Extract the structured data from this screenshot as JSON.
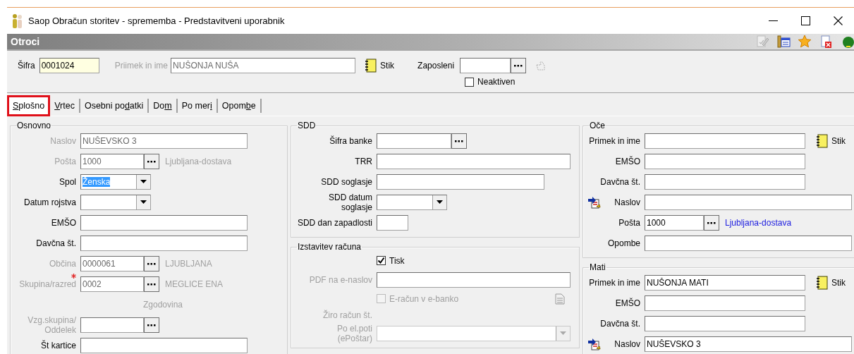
{
  "window": {
    "title": "Saop Obračun storitev - sprememba - Predstavitveni uporabnik"
  },
  "form": {
    "title": "Otroci"
  },
  "header": {
    "code": {
      "label": "Šifra",
      "value": "0001024"
    },
    "name": {
      "label": "Priimek in ime",
      "value": "NUŠONJA NUŠA",
      "disabled": true
    },
    "link": "Stik",
    "employee": {
      "label": "Zaposleni"
    },
    "inactive": {
      "label": "Neaktiven",
      "checked": false
    }
  },
  "tabs": [
    {
      "key": "S",
      "after": "plošno",
      "selected": true,
      "highlighted": true
    },
    {
      "key": "V",
      "after": "rtec",
      "selected": false,
      "highlighted": false
    },
    {
      "before": "Osebni po",
      "key": "d",
      "after": "atki",
      "selected": false,
      "highlighted": false
    },
    {
      "before": "Do",
      "key": "m",
      "selected": false,
      "highlighted": false
    },
    {
      "before": "Po mer",
      "key": "i",
      "selected": false,
      "highlighted": false
    },
    {
      "before": "Opom",
      "key": "b",
      "after": "e",
      "selected": false,
      "highlighted": false
    }
  ],
  "columns": [
    [
      {
        "title": "Osnovno",
        "rows": [
          {
            "kind": "text",
            "label": "Naslov",
            "value": "NUŠEVSKO 3",
            "disabled": true
          },
          {
            "kind": "lookup",
            "label": "Pošta",
            "value": "1000",
            "note": "Ljubljana-dostava",
            "disabled": true
          },
          {
            "kind": "combo",
            "label": "Spol",
            "value": "Ženska",
            "highlighted": true
          },
          {
            "kind": "combo",
            "label": "Datum rojstva"
          },
          {
            "kind": "text",
            "label": "EMŠO"
          },
          {
            "kind": "text",
            "label": "Davčna št."
          },
          {
            "kind": "lookup",
            "label": "Občina",
            "value": "0000061",
            "note": "LJUBLJANA",
            "disabled": true
          },
          {
            "kind": "lookup",
            "label": "Skupina/razred",
            "value": "0002",
            "note": "MEGLICE ENA",
            "disabled": true,
            "required": true
          },
          {
            "kind": "heading",
            "label": "Zgodovina",
            "disabled": true
          },
          {
            "kind": "lookup",
            "label": "Vzg.skupina/\nOddelek",
            "disabled": true
          },
          {
            "kind": "text",
            "label": "Št kartice"
          }
        ]
      }
    ],
    [
      {
        "title": "SDD",
        "rows": [
          {
            "kind": "lookup",
            "label": "Šifra banke"
          },
          {
            "kind": "text",
            "label": "TRR"
          },
          {
            "kind": "text",
            "label": "SDD soglasje"
          },
          {
            "kind": "combo",
            "label": "SDD datum\nsoglasje"
          },
          {
            "kind": "text",
            "label": "SDD dan zapadlosti"
          }
        ]
      },
      {
        "title": "Izstavitev računa",
        "rows": [
          {
            "kind": "checkbox",
            "label": "Tisk",
            "checked": true
          },
          {
            "kind": "text",
            "label": "PDF na e-naslov",
            "disabled": true
          },
          {
            "kind": "checkbox",
            "label": "E-račun v e-banko",
            "checked": false,
            "disabled": true,
            "document_icon": true
          },
          {
            "kind": "info",
            "label": "Žiro račun št.",
            "disabled": true
          },
          {
            "kind": "combo",
            "label": "Po el.poti\n(ePoštar)",
            "disabled": true
          }
        ]
      }
    ],
    [
      {
        "title": "Oče",
        "rows": [
          {
            "kind": "text",
            "label": "Primek in ime",
            "link": "Stik"
          },
          {
            "kind": "text",
            "label": "EMŠO"
          },
          {
            "kind": "text",
            "label": "Davčna št."
          },
          {
            "kind": "text",
            "label": "Naslov",
            "copy_button": true
          },
          {
            "kind": "lookup",
            "label": "Pošta",
            "value": "1000",
            "note": "Ljubljana-dostava",
            "note_link": true
          },
          {
            "kind": "text",
            "label": "Opombe"
          }
        ]
      },
      {
        "title": "Mati",
        "rows": [
          {
            "kind": "text",
            "label": "Primek in ime",
            "value": "NUŠONJA MATI",
            "link": "Stik"
          },
          {
            "kind": "text",
            "label": "EMŠO"
          },
          {
            "kind": "text",
            "label": "Davčna št."
          },
          {
            "kind": "text",
            "label": "Naslov",
            "value": "NUŠEVSKO 3",
            "copy_button": true
          }
        ]
      }
    ]
  ]
}
